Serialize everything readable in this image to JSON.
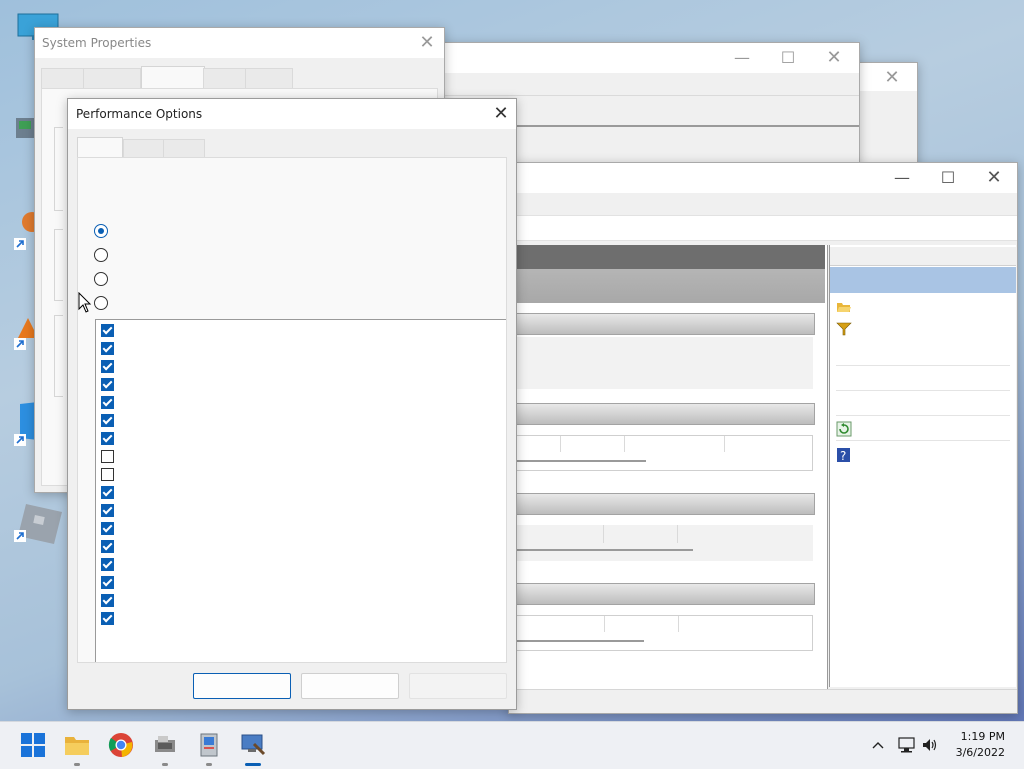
{
  "system_properties": {
    "title": "System Properties"
  },
  "performance_options": {
    "title": "Performance Options"
  },
  "colors": {
    "accent": "#0a5fb4",
    "taskbar": "#eef0f4",
    "window": "#f0f0f0"
  },
  "radio_options": [
    {
      "checked": true
    },
    {
      "checked": false
    },
    {
      "checked": false
    },
    {
      "checked": false
    }
  ],
  "effects_checkboxes": [
    true,
    true,
    true,
    true,
    true,
    true,
    true,
    false,
    false,
    true,
    true,
    true,
    true,
    true,
    true,
    true,
    true
  ],
  "taskbar": {
    "apps": [
      "start-icon",
      "file-explorer-icon",
      "chrome-icon",
      "device-manager-icon",
      "system-properties-icon",
      "computer-management-icon"
    ],
    "tray_icons": [
      "chevron-up-icon",
      "network-icon",
      "volume-icon"
    ],
    "time": "1:19 PM",
    "date": "3/6/2022"
  }
}
